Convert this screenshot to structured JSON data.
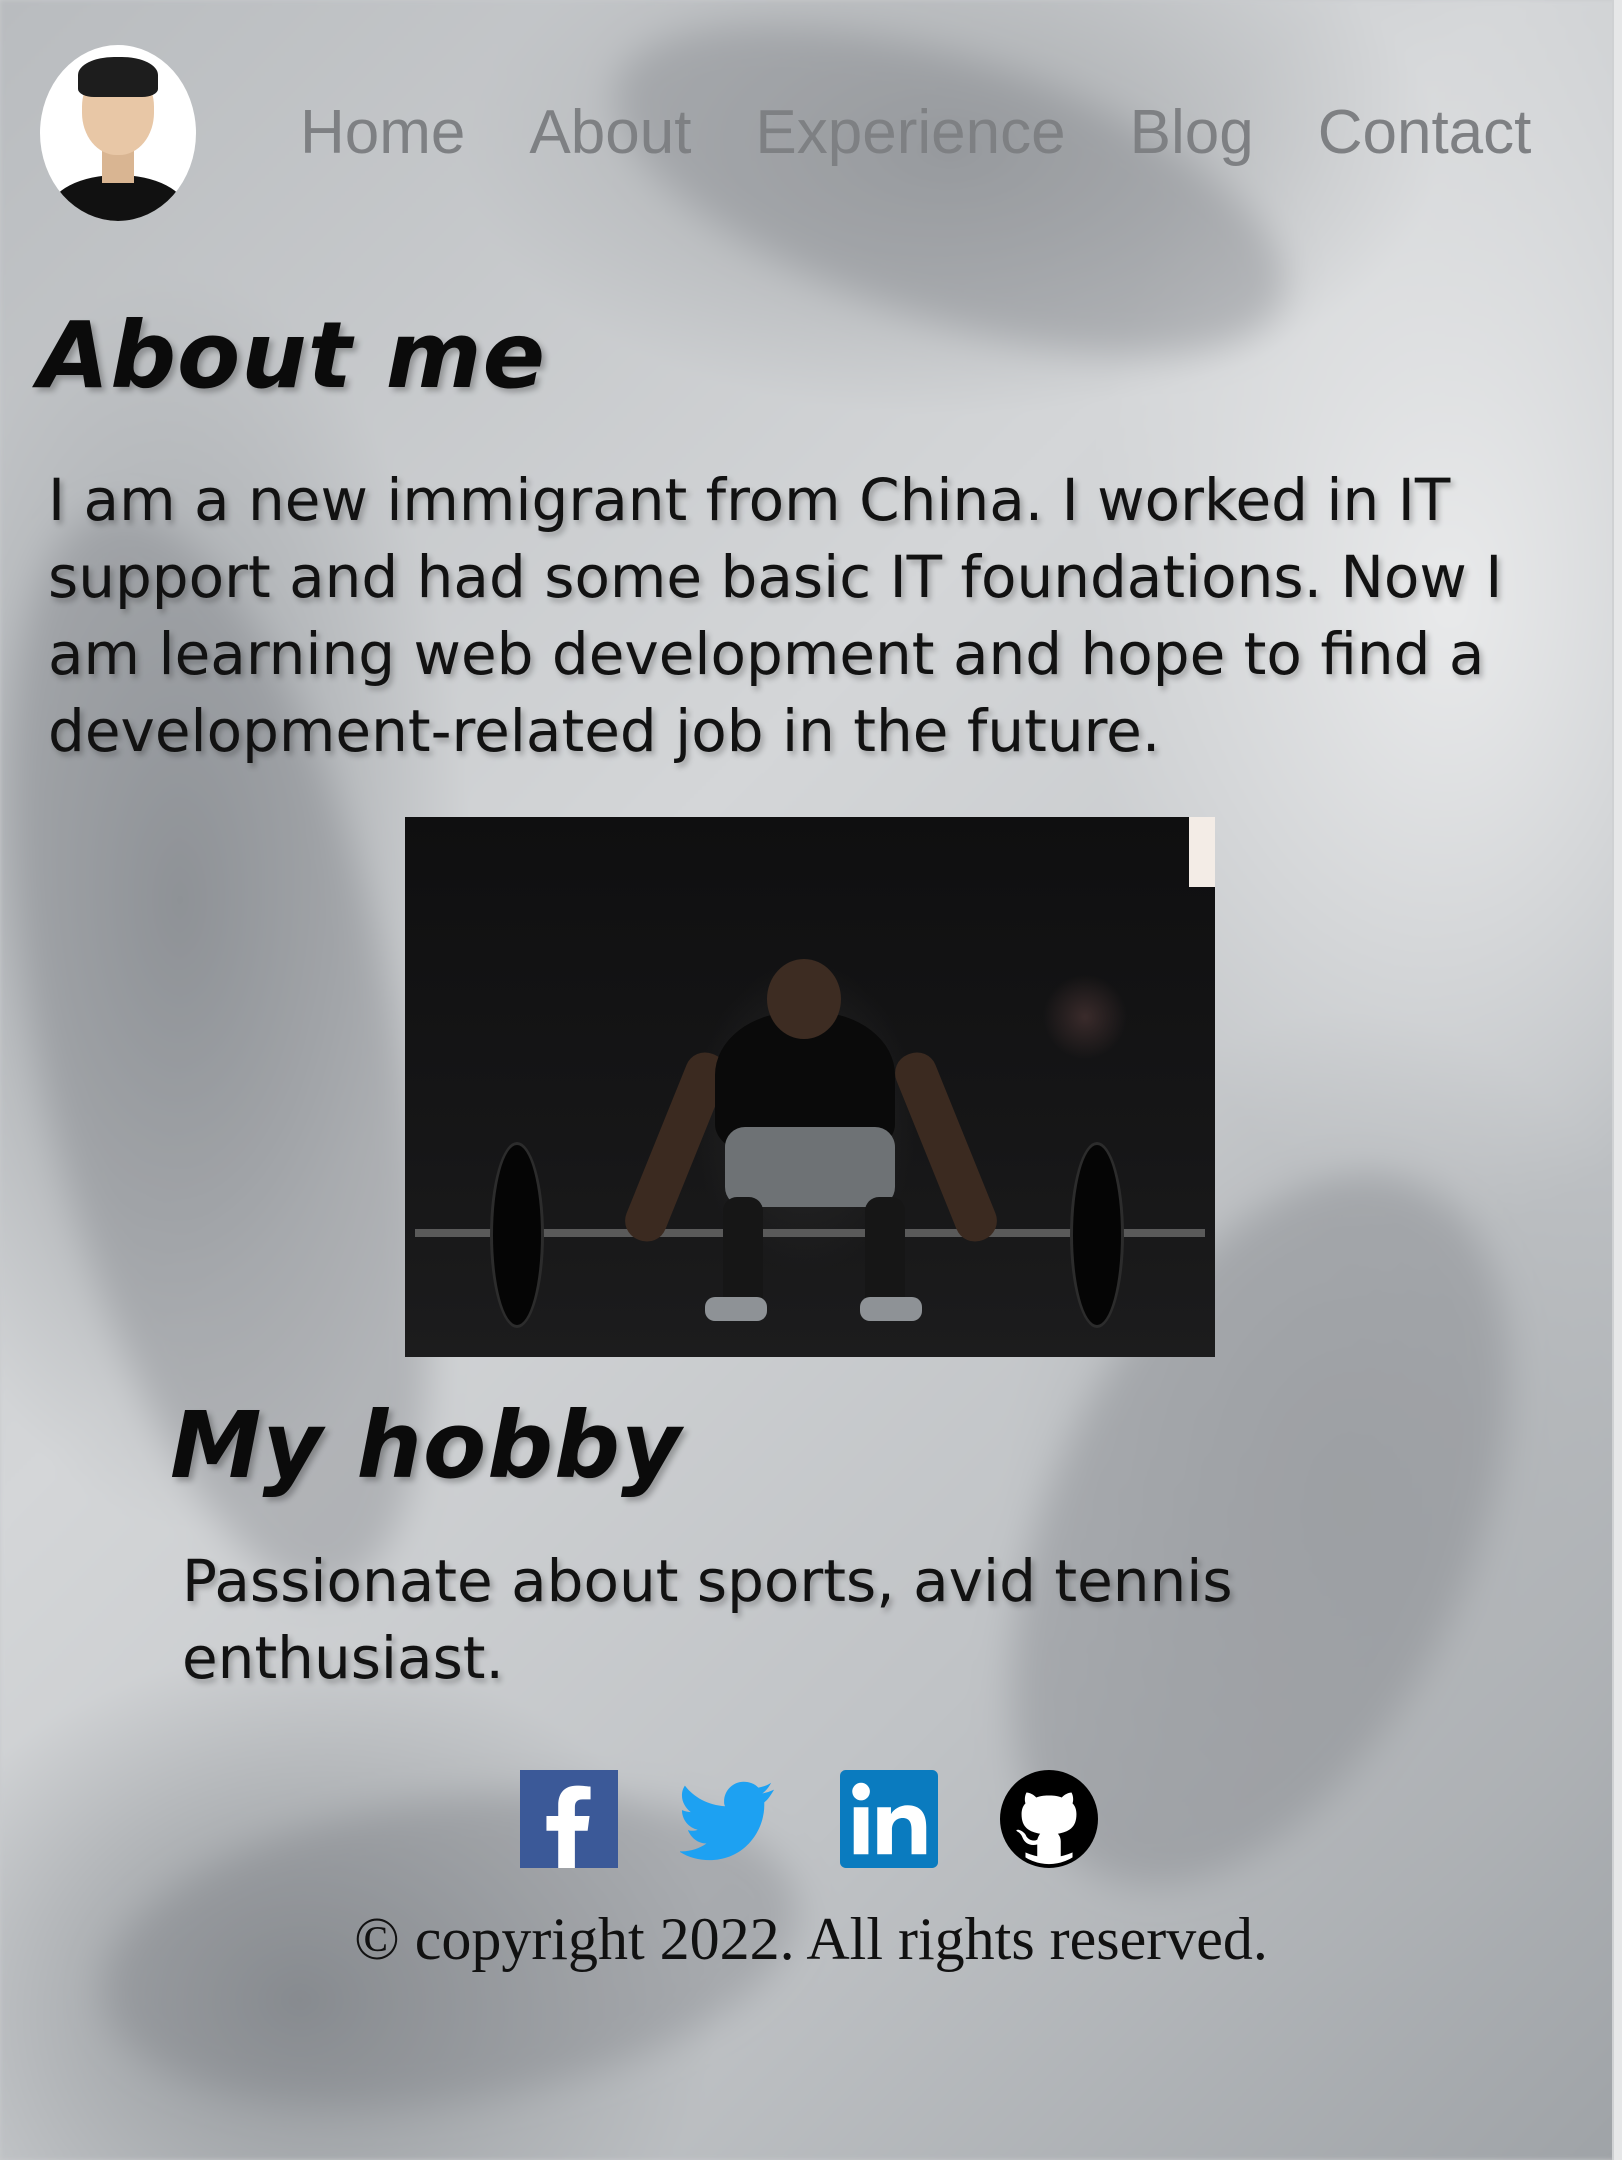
{
  "nav": {
    "items": [
      "Home",
      "About",
      "Experience",
      "Blog",
      "Contact"
    ]
  },
  "profile": {
    "avatar_icon": "profile-photo"
  },
  "about": {
    "title": "About me",
    "text": "I am a new immigrant from China. I worked in IT support and had some basic IT foundations. Now I am learning web development and hope to find a development-related job in the future."
  },
  "photo": {
    "subject": "weightlifting-photo"
  },
  "hobby": {
    "title": "My hobby",
    "text": "Passionate about sports, avid tennis enthusiast."
  },
  "socials": {
    "icons": [
      "facebook-icon",
      "twitter-icon",
      "linkedin-icon",
      "github-icon"
    ],
    "colors": {
      "facebook": "#3b5998",
      "twitter": "#1da1f2",
      "linkedin": "#0a7bbf",
      "github": "#000000"
    }
  },
  "footer": {
    "copyright": "© copyright 2022. All rights reserved."
  }
}
